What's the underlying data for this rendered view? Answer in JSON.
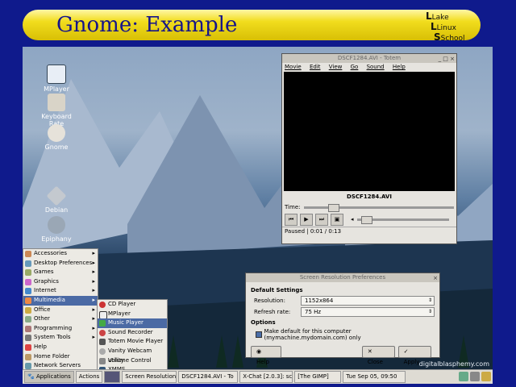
{
  "slide": {
    "title": "Gnome: Example",
    "logo": {
      "line1": "Lake",
      "line2": "Linux",
      "line3": "School"
    }
  },
  "desktop_icons": [
    {
      "label": "MPlayer"
    },
    {
      "label": "Keyboard Rate"
    },
    {
      "label": "Gnome"
    },
    {
      "label": "Debian"
    },
    {
      "label": "Epiphany"
    }
  ],
  "video_window": {
    "title": "DSCF1284.AVI - Totem",
    "menu": [
      "Movie",
      "Edit",
      "View",
      "Go",
      "Sound",
      "Help"
    ],
    "filename": "DSCF1284.AVI",
    "time_label": "Time:",
    "status": "Paused",
    "time": "0:01 / 0:13"
  },
  "dialog": {
    "title": "Screen Resolution Preferences",
    "section1": "Default Settings",
    "resolution_label": "Resolution:",
    "resolution_value": "1152x864",
    "refresh_label": "Refresh rate:",
    "refresh_value": "75 Hz",
    "section2": "Options",
    "checkbox_label": "Make default for this computer (mymachine.mydomain.com) only",
    "help": "Help",
    "close": "Close",
    "apply": "Apply"
  },
  "apps_menu": [
    {
      "label": "Accessories",
      "arrow": "▸"
    },
    {
      "label": "Desktop Preferences",
      "arrow": "▸"
    },
    {
      "label": "Games",
      "arrow": "▸"
    },
    {
      "label": "Graphics",
      "arrow": "▸"
    },
    {
      "label": "Internet",
      "arrow": "▸"
    },
    {
      "label": "Multimedia",
      "arrow": "▸"
    },
    {
      "label": "Office",
      "arrow": "▸"
    },
    {
      "label": "Other",
      "arrow": "▸"
    },
    {
      "label": "Programming",
      "arrow": "▸"
    },
    {
      "label": "System Tools",
      "arrow": "▸"
    },
    {
      "label": "Help",
      "arrow": ""
    },
    {
      "label": "Home Folder",
      "arrow": ""
    },
    {
      "label": "Network Servers",
      "arrow": ""
    }
  ],
  "multimedia_menu": [
    {
      "label": "CD Player"
    },
    {
      "label": "MPlayer"
    },
    {
      "label": "Music Player"
    },
    {
      "label": "Sound Recorder"
    },
    {
      "label": "Totem Movie Player"
    },
    {
      "label": "Vanity Webcam utility"
    },
    {
      "label": "Volume Control"
    },
    {
      "label": "XMMS"
    }
  ],
  "taskbar": {
    "applications": "Applications",
    "actions": "Actions",
    "items": [
      "Screen Resolution",
      "DSCF1284.AVI - To",
      "X-Chat [2.0.3]: sc",
      "[The GIMP]"
    ],
    "clock": "Tue Sep 05, 09:50"
  },
  "watermark": "digitalblasphemy.com"
}
